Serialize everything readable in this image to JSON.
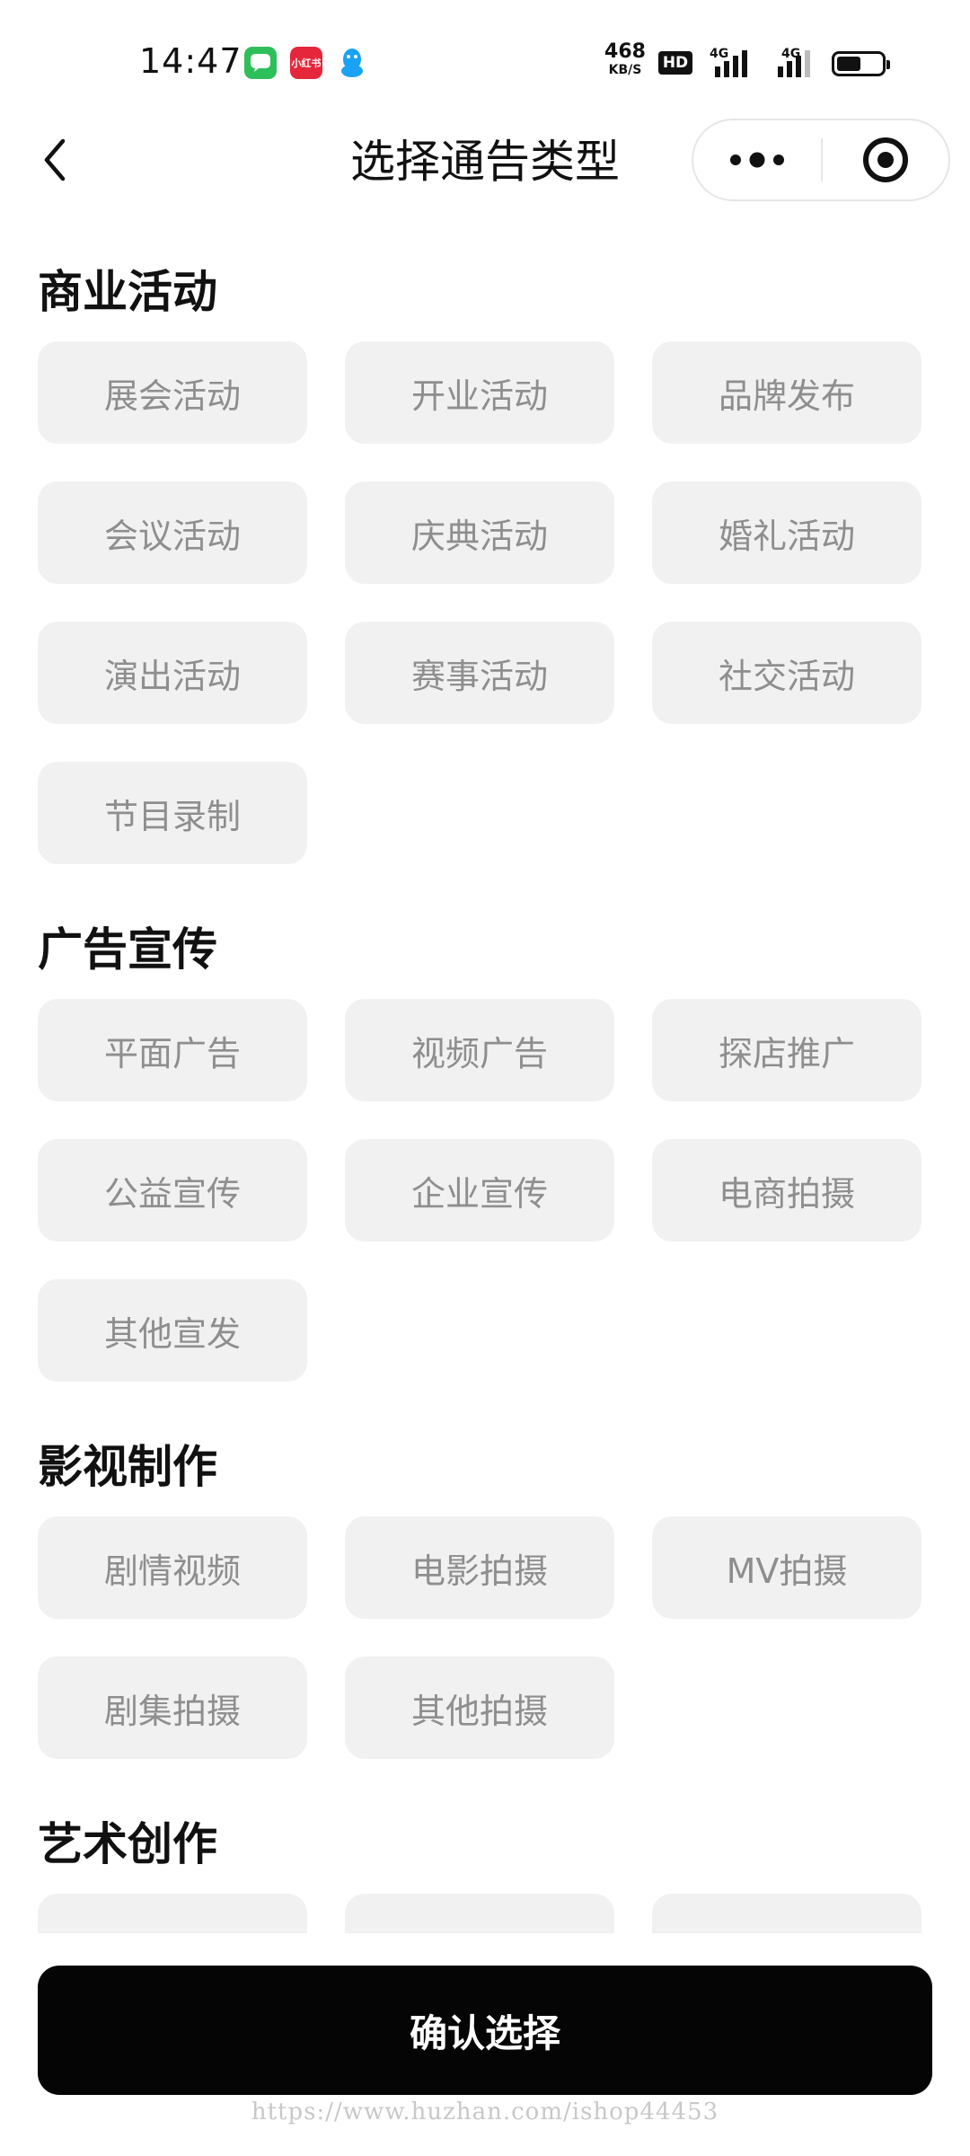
{
  "status_bar": {
    "time": "14:47",
    "net_speed_value": "468",
    "net_speed_unit": "KB/S",
    "hd_label": "HD",
    "signal1_label": "4G",
    "signal2_label": "4G",
    "app_icons": [
      "message-icon",
      "xiaohongshu-icon",
      "qq-icon"
    ],
    "red_app_label": "小红书",
    "battery_level": 0.55
  },
  "nav": {
    "title": "选择通告类型"
  },
  "sections": [
    {
      "title": "商业活动",
      "items": [
        "展会活动",
        "开业活动",
        "品牌发布",
        "会议活动",
        "庆典活动",
        "婚礼活动",
        "演出活动",
        "赛事活动",
        "社交活动",
        "节目录制"
      ]
    },
    {
      "title": "广告宣传",
      "items": [
        "平面广告",
        "视频广告",
        "探店推广",
        "公益宣传",
        "企业宣传",
        "电商拍摄",
        "其他宣发"
      ]
    },
    {
      "title": "影视制作",
      "items": [
        "剧情视频",
        "电影拍摄",
        "MV拍摄",
        "剧集拍摄",
        "其他拍摄"
      ]
    },
    {
      "title": "艺术创作",
      "items": [
        "",
        "",
        ""
      ]
    }
  ],
  "confirm_label": "确认选择",
  "watermark": "https://www.huzhan.com/ishop44453",
  "colors": {
    "chip_bg": "#f1f1f1",
    "chip_text": "#8e8e8e",
    "button_bg": "#050505",
    "button_text": "#ffffff"
  }
}
